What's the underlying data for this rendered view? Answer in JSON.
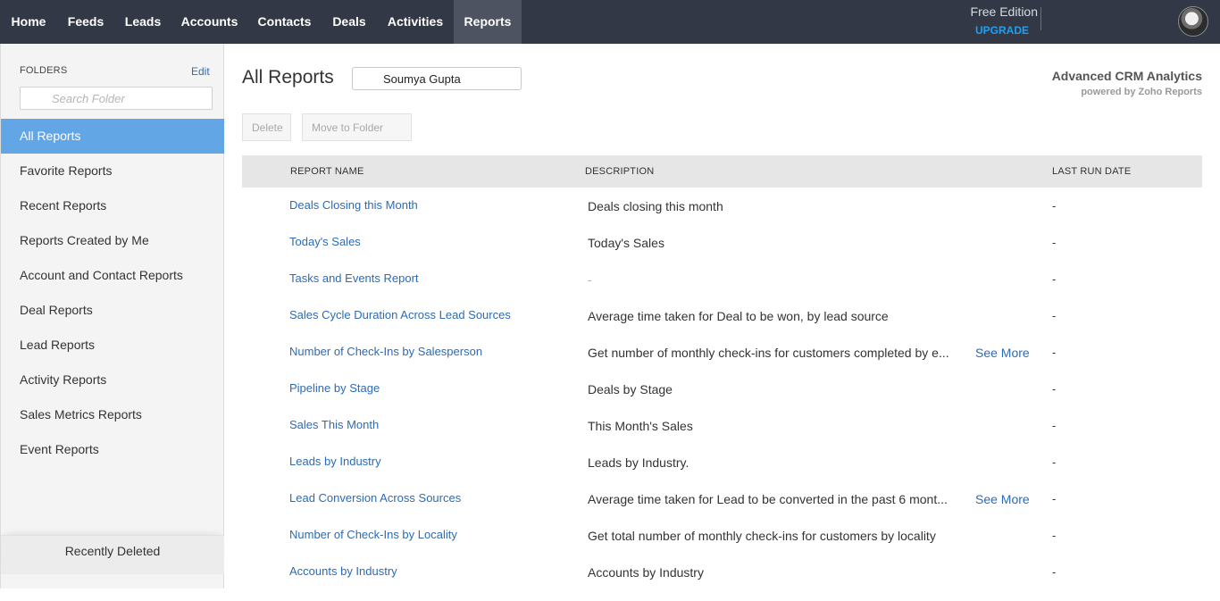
{
  "nav": {
    "items": [
      {
        "label": "Home"
      },
      {
        "label": "Feeds"
      },
      {
        "label": "Leads"
      },
      {
        "label": "Accounts"
      },
      {
        "label": "Contacts"
      },
      {
        "label": "Deals"
      },
      {
        "label": "Activities"
      },
      {
        "label": "Reports",
        "active": true
      }
    ],
    "edition": "Free Edition",
    "upgrade": "UPGRADE"
  },
  "sidebar": {
    "folders_label": "FOLDERS",
    "edit_label": "Edit",
    "search_placeholder": "Search Folder",
    "items": [
      {
        "label": "All Reports",
        "active": true
      },
      {
        "label": "Favorite Reports"
      },
      {
        "label": "Recent Reports"
      },
      {
        "label": "Reports Created by Me"
      },
      {
        "label": "Account and Contact Reports"
      },
      {
        "label": "Deal Reports"
      },
      {
        "label": "Lead Reports"
      },
      {
        "label": "Activity Reports"
      },
      {
        "label": "Sales Metrics Reports"
      },
      {
        "label": "Event Reports"
      }
    ],
    "recently_deleted": "Recently Deleted"
  },
  "main": {
    "title": "All Reports",
    "search_value": "Soumya Gupta",
    "analytics_title": "Advanced CRM Analytics",
    "analytics_sub": "powered by Zoho Reports",
    "delete_label": "Delete",
    "move_label": "Move to Folder",
    "columns": {
      "name": "REPORT NAME",
      "description": "DESCRIPTION",
      "last_run": "LAST RUN DATE"
    },
    "see_more_label": "See More",
    "rows": [
      {
        "name": "Deals Closing this Month",
        "description": "Deals closing this month",
        "last_run": "-"
      },
      {
        "name": "Today's Sales",
        "description": "Today's Sales",
        "last_run": "-"
      },
      {
        "name": "Tasks and Events Report",
        "description": "-",
        "last_run": "-"
      },
      {
        "name": "Sales Cycle Duration Across Lead Sources",
        "description": "Average time taken for Deal to be won, by lead source",
        "last_run": "-"
      },
      {
        "name": "Number of Check-Ins by Salesperson",
        "description": "Get number of monthly check-ins for customers completed by e...",
        "last_run": "-",
        "see_more": true
      },
      {
        "name": "Pipeline by Stage",
        "description": "Deals by Stage",
        "last_run": "-"
      },
      {
        "name": "Sales This Month",
        "description": "This Month's Sales",
        "last_run": "-"
      },
      {
        "name": "Leads by Industry",
        "description": "Leads by Industry.",
        "last_run": "-"
      },
      {
        "name": "Lead Conversion Across Sources",
        "description": "Average time taken for Lead to be converted in the past 6 mont...",
        "last_run": "-",
        "see_more": true
      },
      {
        "name": "Number of Check-Ins by Locality",
        "description": "Get total number of monthly check-ins for customers by locality",
        "last_run": "-"
      },
      {
        "name": "Accounts by Industry",
        "description": "Accounts by Industry",
        "last_run": "-"
      }
    ]
  }
}
